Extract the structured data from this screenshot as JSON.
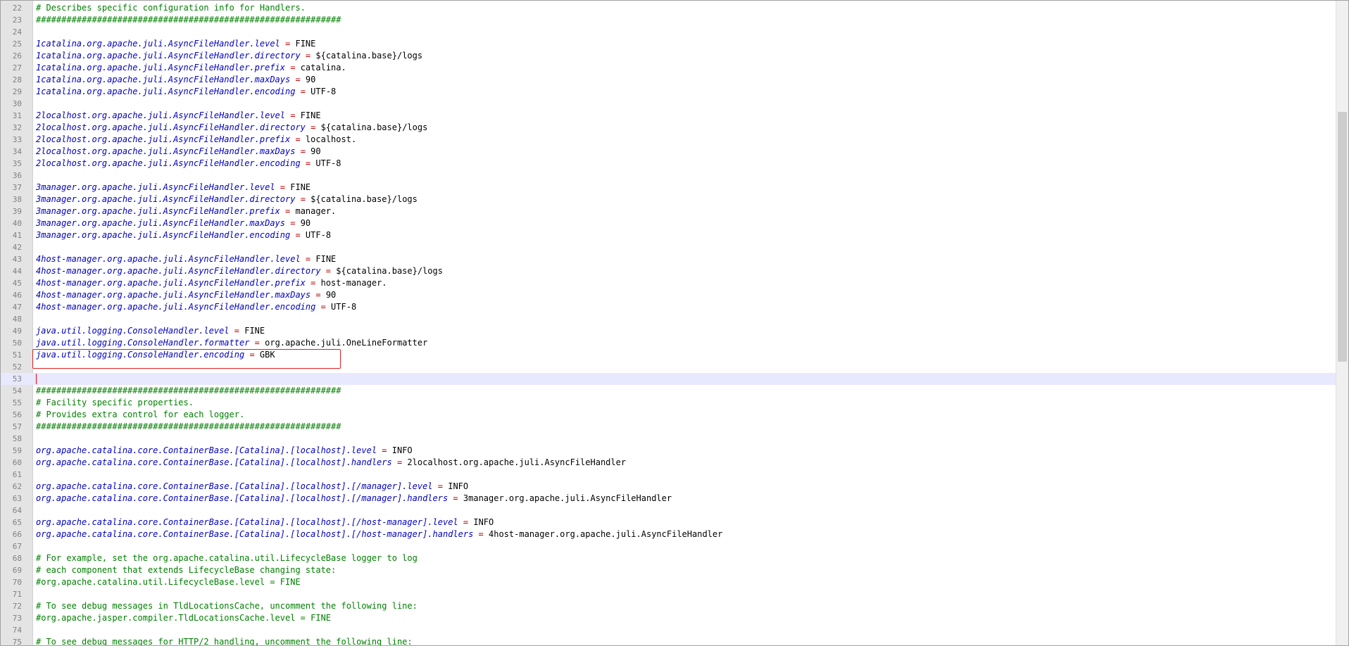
{
  "editor": {
    "lines": [
      {
        "num": "22",
        "kind": "comment",
        "text": "# Describes specific configuration info for Handlers."
      },
      {
        "num": "23",
        "kind": "comment",
        "text": "############################################################"
      },
      {
        "num": "24",
        "kind": "blank"
      },
      {
        "num": "25",
        "kind": "prop",
        "key": "1catalina.org.apache.juli.AsyncFileHandler.level",
        "value": "FINE"
      },
      {
        "num": "26",
        "kind": "prop",
        "key": "1catalina.org.apache.juli.AsyncFileHandler.directory",
        "value": "${catalina.base}/logs"
      },
      {
        "num": "27",
        "kind": "prop",
        "key": "1catalina.org.apache.juli.AsyncFileHandler.prefix",
        "value": "catalina."
      },
      {
        "num": "28",
        "kind": "prop",
        "key": "1catalina.org.apache.juli.AsyncFileHandler.maxDays",
        "value": "90"
      },
      {
        "num": "29",
        "kind": "prop",
        "key": "1catalina.org.apache.juli.AsyncFileHandler.encoding",
        "value": "UTF-8"
      },
      {
        "num": "30",
        "kind": "blank"
      },
      {
        "num": "31",
        "kind": "prop",
        "key": "2localhost.org.apache.juli.AsyncFileHandler.level",
        "value": "FINE"
      },
      {
        "num": "32",
        "kind": "prop",
        "key": "2localhost.org.apache.juli.AsyncFileHandler.directory",
        "value": "${catalina.base}/logs"
      },
      {
        "num": "33",
        "kind": "prop",
        "key": "2localhost.org.apache.juli.AsyncFileHandler.prefix",
        "value": "localhost."
      },
      {
        "num": "34",
        "kind": "prop",
        "key": "2localhost.org.apache.juli.AsyncFileHandler.maxDays",
        "value": "90"
      },
      {
        "num": "35",
        "kind": "prop",
        "key": "2localhost.org.apache.juli.AsyncFileHandler.encoding",
        "value": "UTF-8"
      },
      {
        "num": "36",
        "kind": "blank"
      },
      {
        "num": "37",
        "kind": "prop",
        "key": "3manager.org.apache.juli.AsyncFileHandler.level",
        "value": "FINE"
      },
      {
        "num": "38",
        "kind": "prop",
        "key": "3manager.org.apache.juli.AsyncFileHandler.directory",
        "value": "${catalina.base}/logs"
      },
      {
        "num": "39",
        "kind": "prop",
        "key": "3manager.org.apache.juli.AsyncFileHandler.prefix",
        "value": "manager."
      },
      {
        "num": "40",
        "kind": "prop",
        "key": "3manager.org.apache.juli.AsyncFileHandler.maxDays",
        "value": "90"
      },
      {
        "num": "41",
        "kind": "prop",
        "key": "3manager.org.apache.juli.AsyncFileHandler.encoding",
        "value": "UTF-8"
      },
      {
        "num": "42",
        "kind": "blank"
      },
      {
        "num": "43",
        "kind": "prop",
        "key": "4host-manager.org.apache.juli.AsyncFileHandler.level",
        "value": "FINE"
      },
      {
        "num": "44",
        "kind": "prop",
        "key": "4host-manager.org.apache.juli.AsyncFileHandler.directory",
        "value": "${catalina.base}/logs"
      },
      {
        "num": "45",
        "kind": "prop",
        "key": "4host-manager.org.apache.juli.AsyncFileHandler.prefix",
        "value": "host-manager."
      },
      {
        "num": "46",
        "kind": "prop",
        "key": "4host-manager.org.apache.juli.AsyncFileHandler.maxDays",
        "value": "90"
      },
      {
        "num": "47",
        "kind": "prop",
        "key": "4host-manager.org.apache.juli.AsyncFileHandler.encoding",
        "value": "UTF-8"
      },
      {
        "num": "48",
        "kind": "blank"
      },
      {
        "num": "49",
        "kind": "prop",
        "key": "java.util.logging.ConsoleHandler.level",
        "value": "FINE"
      },
      {
        "num": "50",
        "kind": "prop",
        "key": "java.util.logging.ConsoleHandler.formatter",
        "value": "org.apache.juli.OneLineFormatter"
      },
      {
        "num": "51",
        "kind": "prop",
        "key": "java.util.logging.ConsoleHandler.encoding",
        "value": "GBK"
      },
      {
        "num": "52",
        "kind": "blank"
      },
      {
        "num": "53",
        "kind": "blank",
        "current": true
      },
      {
        "num": "54",
        "kind": "comment",
        "text": "############################################################"
      },
      {
        "num": "55",
        "kind": "comment",
        "text": "# Facility specific properties."
      },
      {
        "num": "56",
        "kind": "comment",
        "text": "# Provides extra control for each logger."
      },
      {
        "num": "57",
        "kind": "comment",
        "text": "############################################################"
      },
      {
        "num": "58",
        "kind": "blank"
      },
      {
        "num": "59",
        "kind": "prop",
        "key": "org.apache.catalina.core.ContainerBase.[Catalina].[localhost].level",
        "value": "INFO"
      },
      {
        "num": "60",
        "kind": "prop",
        "key": "org.apache.catalina.core.ContainerBase.[Catalina].[localhost].handlers",
        "value": "2localhost.org.apache.juli.AsyncFileHandler"
      },
      {
        "num": "61",
        "kind": "blank"
      },
      {
        "num": "62",
        "kind": "prop",
        "key": "org.apache.catalina.core.ContainerBase.[Catalina].[localhost].[/manager].level",
        "value": "INFO"
      },
      {
        "num": "63",
        "kind": "prop",
        "key": "org.apache.catalina.core.ContainerBase.[Catalina].[localhost].[/manager].handlers",
        "value": "3manager.org.apache.juli.AsyncFileHandler"
      },
      {
        "num": "64",
        "kind": "blank"
      },
      {
        "num": "65",
        "kind": "prop",
        "key": "org.apache.catalina.core.ContainerBase.[Catalina].[localhost].[/host-manager].level",
        "value": "INFO"
      },
      {
        "num": "66",
        "kind": "prop",
        "key": "org.apache.catalina.core.ContainerBase.[Catalina].[localhost].[/host-manager].handlers",
        "value": "4host-manager.org.apache.juli.AsyncFileHandler"
      },
      {
        "num": "67",
        "kind": "blank"
      },
      {
        "num": "68",
        "kind": "comment",
        "text": "# For example, set the org.apache.catalina.util.LifecycleBase logger to log"
      },
      {
        "num": "69",
        "kind": "comment",
        "text": "# each component that extends LifecycleBase changing state:"
      },
      {
        "num": "70",
        "kind": "comment",
        "text": "#org.apache.catalina.util.LifecycleBase.level = FINE"
      },
      {
        "num": "71",
        "kind": "blank"
      },
      {
        "num": "72",
        "kind": "comment",
        "text": "# To see debug messages in TldLocationsCache, uncomment the following line:"
      },
      {
        "num": "73",
        "kind": "comment",
        "text": "#org.apache.jasper.compiler.TldLocationsCache.level = FINE"
      },
      {
        "num": "74",
        "kind": "blank"
      },
      {
        "num": "75",
        "kind": "comment",
        "text": "# To see debug messages for HTTP/2 handling, uncomment the following line:"
      }
    ],
    "colors": {
      "comment": "#008000",
      "key": "#0000c0",
      "operator": "#c00000",
      "current_line": "#e8e8ff",
      "highlight_box": "#e02020"
    }
  }
}
